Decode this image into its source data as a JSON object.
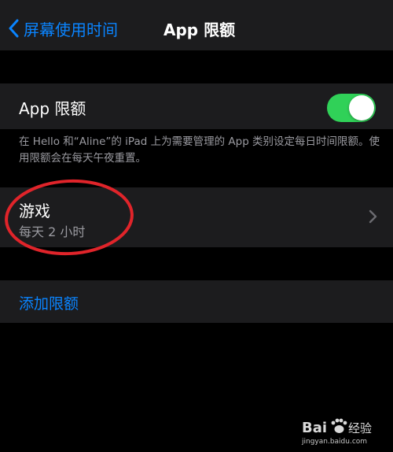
{
  "navbar": {
    "back_label": "屏幕使用时间",
    "title": "App 限额"
  },
  "app_limits_toggle": {
    "label": "App 限额",
    "enabled": true
  },
  "footer_note": "在 Hello 和“Aline”的 iPad 上为需要管理的 App 类别设定每日时间限额。使用限额会在每天午夜重置。",
  "limit_item": {
    "title": "游戏",
    "subtitle": "每天 2 小时"
  },
  "add_limit_label": "添加限额",
  "colors": {
    "accent": "#0a84ff",
    "toggle_on": "#30d158",
    "annotation": "#e0242a",
    "background": "#000000",
    "cell": "#1c1c1e",
    "secondary_text": "#9a9aa0"
  },
  "watermark": {
    "brand": "Bai 经验",
    "url": "jingyan.baidu.com"
  }
}
